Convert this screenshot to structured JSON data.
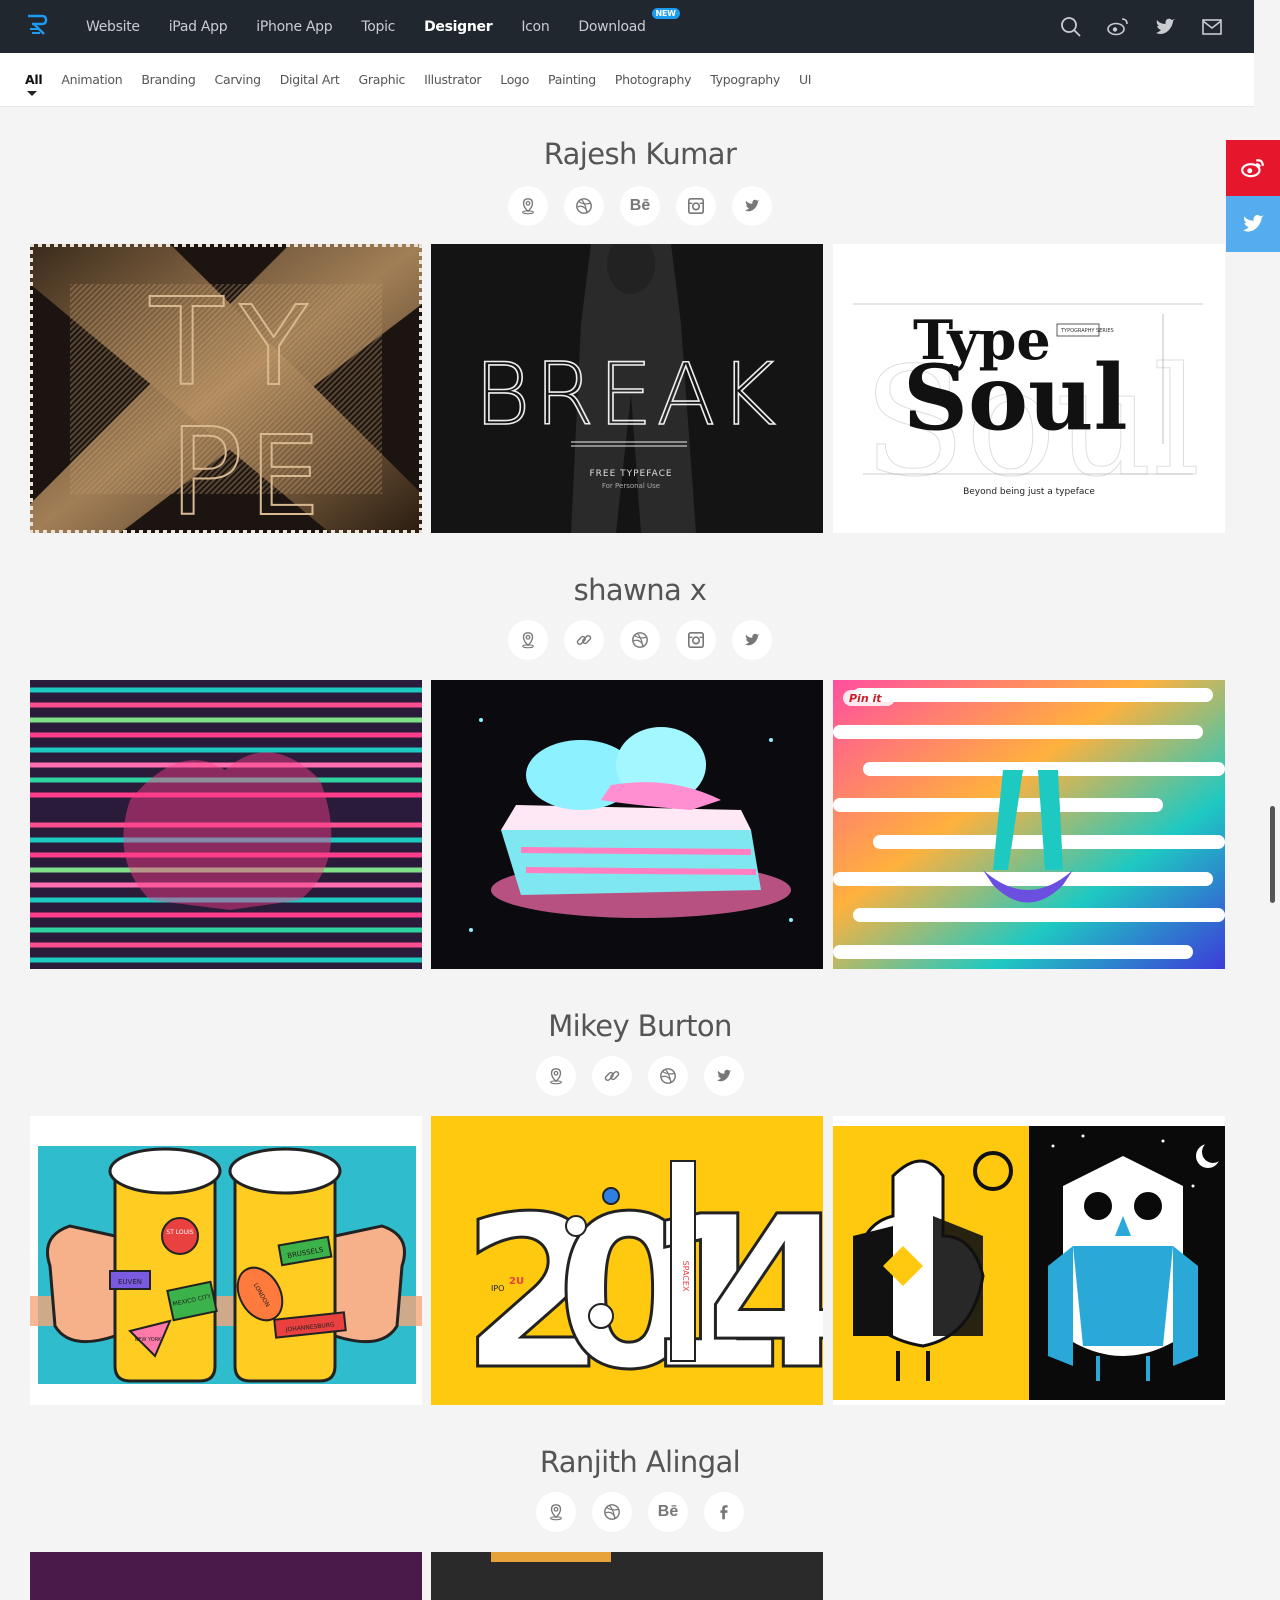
{
  "nav": {
    "items": [
      {
        "label": "Website"
      },
      {
        "label": "iPad App"
      },
      {
        "label": "iPhone App"
      },
      {
        "label": "Topic"
      },
      {
        "label": "Designer"
      },
      {
        "label": "Icon"
      },
      {
        "label": "Download"
      }
    ],
    "active": "Designer",
    "download_badge": "NEW",
    "icons": [
      "search-icon",
      "weibo-icon",
      "twitter-icon",
      "mail-icon"
    ]
  },
  "categories": {
    "items": [
      "All",
      "Animation",
      "Branding",
      "Carving",
      "Digital Art",
      "Graphic",
      "Illustrator",
      "Logo",
      "Painting",
      "Photography",
      "Typography",
      "UI"
    ],
    "active": "All"
  },
  "share": {
    "icons": [
      "weibo-icon",
      "twitter-icon"
    ],
    "colors": [
      "#e6162d",
      "#55acee"
    ]
  },
  "designers": [
    {
      "name": "Rajesh Kumar",
      "socials": [
        "location-icon",
        "dribbble-icon",
        "behance-icon",
        "instagram-icon",
        "twitter-icon"
      ],
      "works": [
        {
          "texts": [
            "T",
            "Y",
            "P",
            "E"
          ]
        },
        {
          "texts": [
            "BREAK",
            "FREE TYPEFACE",
            "For Personal Use"
          ]
        },
        {
          "texts": [
            "Type",
            "Soul",
            "Beyond being just a typeface",
            "TYPOGRAPHY SERIES"
          ]
        }
      ]
    },
    {
      "name": "shawna x",
      "socials": [
        "location-icon",
        "link-icon",
        "dribbble-icon",
        "instagram-icon",
        "twitter-icon"
      ],
      "works": [
        {
          "texts": []
        },
        {
          "texts": []
        },
        {
          "texts": [
            "Pin it"
          ]
        }
      ]
    },
    {
      "name": "Mikey Burton",
      "socials": [
        "location-icon",
        "link-icon",
        "dribbble-icon",
        "twitter-icon"
      ],
      "works": [
        {
          "texts": [
            "ST LOUIS",
            "BRUSSELS",
            "EUVEN",
            "MEXICO CITY",
            "LONDON",
            "NEW YORK",
            "JOHANNESBURG"
          ]
        },
        {
          "texts": [
            "2",
            "0",
            "1",
            "4",
            "SPACEX",
            "IPO",
            "2U"
          ]
        },
        {
          "texts": []
        }
      ]
    },
    {
      "name": "Ranjith Alingal",
      "socials": [
        "location-icon",
        "dribbble-icon",
        "behance-icon",
        "facebook-icon"
      ],
      "works": []
    }
  ]
}
